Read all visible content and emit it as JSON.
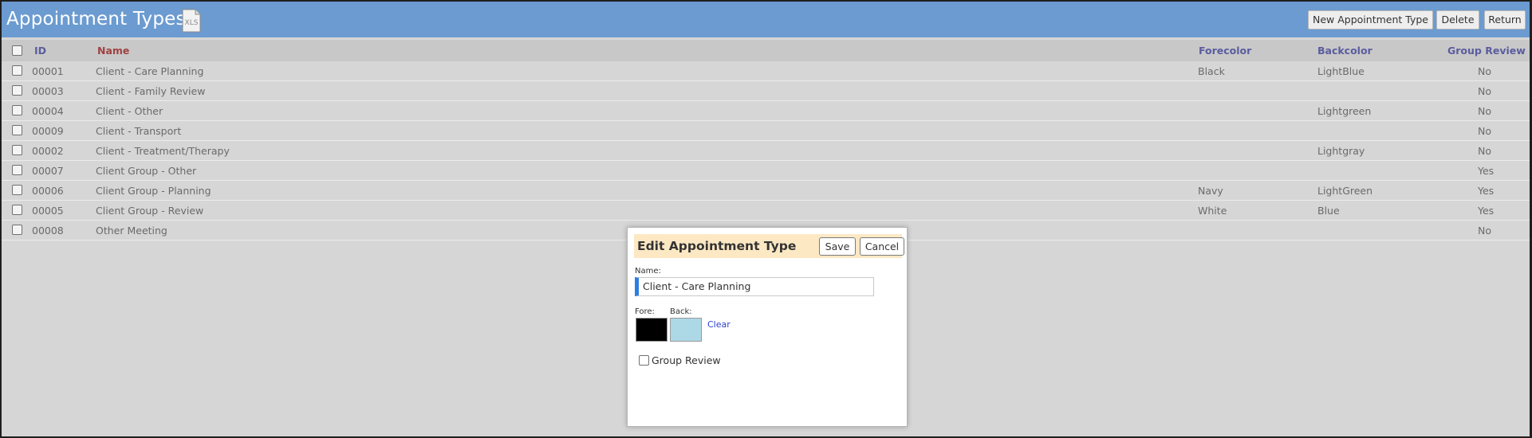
{
  "header": {
    "title": "Appointment Types",
    "xls_label": "XLS",
    "buttons": {
      "new": "New Appointment Type",
      "delete": "Delete",
      "return": "Return"
    }
  },
  "table": {
    "columns": {
      "id": "ID",
      "name": "Name",
      "forecolor": "Forecolor",
      "backcolor": "Backcolor",
      "group_review": "Group Review"
    },
    "rows": [
      {
        "id": "00001",
        "name": "Client - Care Planning",
        "forecolor": "Black",
        "backcolor": "LightBlue",
        "group_review": "No"
      },
      {
        "id": "00003",
        "name": "Client - Family Review",
        "forecolor": "",
        "backcolor": "",
        "group_review": "No"
      },
      {
        "id": "00004",
        "name": "Client - Other",
        "forecolor": "",
        "backcolor": "Lightgreen",
        "group_review": "No"
      },
      {
        "id": "00009",
        "name": "Client - Transport",
        "forecolor": "",
        "backcolor": "",
        "group_review": "No"
      },
      {
        "id": "00002",
        "name": "Client - Treatment/Therapy",
        "forecolor": "",
        "backcolor": "Lightgray",
        "group_review": "No"
      },
      {
        "id": "00007",
        "name": "Client Group - Other",
        "forecolor": "",
        "backcolor": "",
        "group_review": "Yes"
      },
      {
        "id": "00006",
        "name": "Client Group - Planning",
        "forecolor": "Navy",
        "backcolor": "LightGreen",
        "group_review": "Yes"
      },
      {
        "id": "00005",
        "name": "Client Group - Review",
        "forecolor": "White",
        "backcolor": "Blue",
        "group_review": "Yes"
      },
      {
        "id": "00008",
        "name": "Other Meeting",
        "forecolor": "",
        "backcolor": "",
        "group_review": "No"
      }
    ]
  },
  "modal": {
    "title": "Edit Appointment Type",
    "save_label": "Save",
    "cancel_label": "Cancel",
    "name_label": "Name:",
    "name_value": "Client - Care Planning",
    "fore_label": "Fore:",
    "back_label": "Back:",
    "fore_color": "#000000",
    "back_color": "#add8e6",
    "clear_label": "Clear",
    "group_review_label": "Group Review",
    "group_review_checked": false
  },
  "colors": {
    "header_bg": "#6b9bd0",
    "page_bg": "#d6d6d6",
    "column_head_text": "#5b5c9e",
    "name_head_text": "#a04242",
    "modal_head_bg": "#fde8c4",
    "input_accent": "#2f7de1"
  }
}
